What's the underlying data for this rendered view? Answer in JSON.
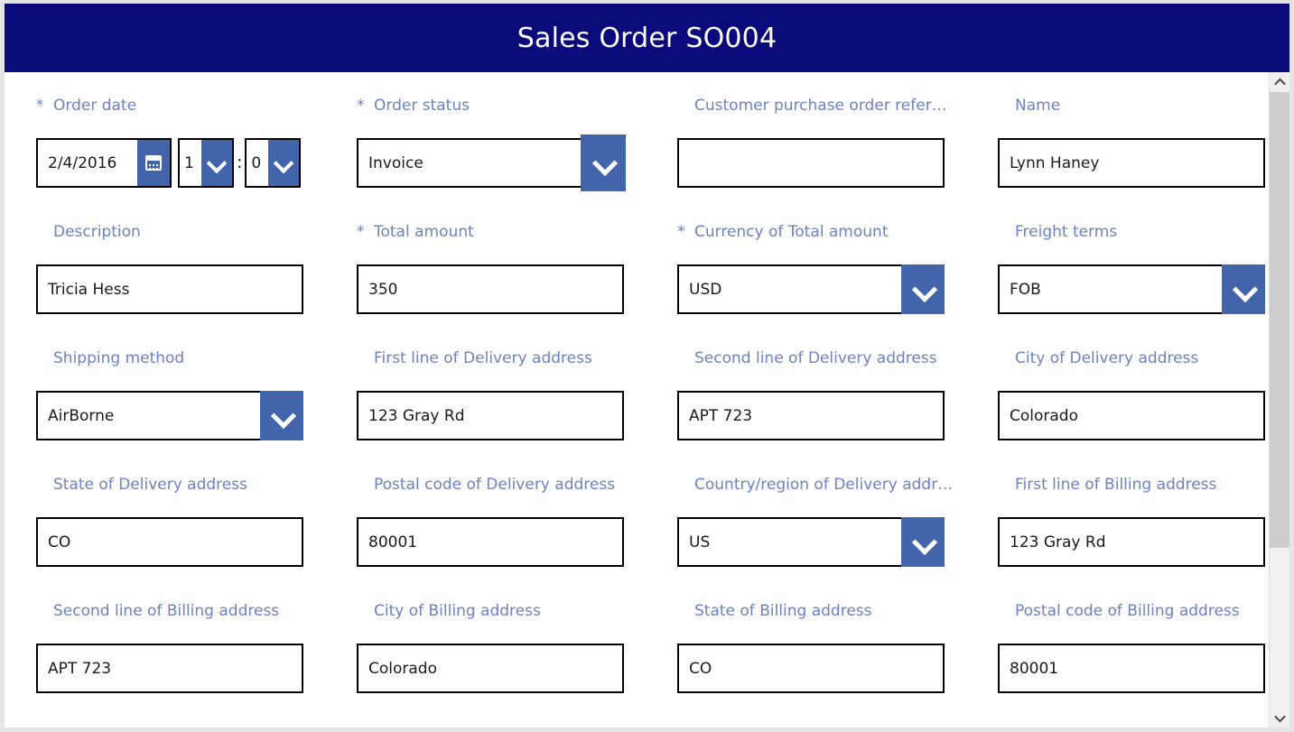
{
  "header": {
    "title": "Sales Order SO004",
    "background": "#0a0a7a",
    "text_color": "#ffffff"
  },
  "theme": {
    "label_color": "#6b83c4",
    "accent_button": "#4264ab",
    "field_border": "#000000",
    "panel_background": "#ffffff",
    "page_background": "#e4e4e4"
  },
  "form": {
    "required_marker": "*",
    "fields": [
      {
        "label": "Order date",
        "required": true,
        "type": "datetime",
        "date_value": "2/4/2016",
        "hour_value": "1",
        "time_separator": ":",
        "minute_value": "0",
        "calendar_icon": "calendar-icon",
        "chevron_icon": "chevron-down-icon"
      },
      {
        "label": "Order status",
        "required": true,
        "type": "dropdown",
        "value": "Invoice",
        "focused": true,
        "chevron_icon": "chevron-down-icon"
      },
      {
        "label": "Customer purchase order refer…",
        "required": false,
        "type": "text",
        "value": ""
      },
      {
        "label": "Name",
        "required": false,
        "type": "text",
        "value": "Lynn Haney"
      },
      {
        "label": "Description",
        "required": false,
        "type": "text",
        "value": "Tricia Hess"
      },
      {
        "label": "Total amount",
        "required": true,
        "type": "text",
        "value": "350"
      },
      {
        "label": "Currency of Total amount",
        "required": true,
        "type": "dropdown",
        "value": "USD",
        "chevron_icon": "chevron-down-icon"
      },
      {
        "label": "Freight terms",
        "required": false,
        "type": "dropdown",
        "value": "FOB",
        "chevron_icon": "chevron-down-icon"
      },
      {
        "label": "Shipping method",
        "required": false,
        "type": "dropdown",
        "value": "AirBorne",
        "chevron_icon": "chevron-down-icon"
      },
      {
        "label": "First line of Delivery address",
        "required": false,
        "type": "text",
        "value": "123 Gray Rd"
      },
      {
        "label": "Second line of Delivery address",
        "required": false,
        "type": "text",
        "value": "APT 723"
      },
      {
        "label": "City of Delivery address",
        "required": false,
        "type": "text",
        "value": "Colorado"
      },
      {
        "label": "State of Delivery address",
        "required": false,
        "type": "text",
        "value": "CO"
      },
      {
        "label": "Postal code of Delivery address",
        "required": false,
        "type": "text",
        "value": "80001"
      },
      {
        "label": "Country/region of Delivery addr…",
        "required": false,
        "type": "dropdown",
        "value": "US",
        "chevron_icon": "chevron-down-icon"
      },
      {
        "label": "First line of Billing address",
        "required": false,
        "type": "text",
        "value": "123 Gray Rd"
      },
      {
        "label": "Second line of Billing address",
        "required": false,
        "type": "text",
        "value": "APT 723"
      },
      {
        "label": "City of Billing address",
        "required": false,
        "type": "text",
        "value": "Colorado"
      },
      {
        "label": "State of Billing address",
        "required": false,
        "type": "text",
        "value": "CO"
      },
      {
        "label": "Postal code of Billing address",
        "required": false,
        "type": "text",
        "value": "80001"
      }
    ]
  },
  "scrollbar": {
    "up_arrow_icon": "chevron-up-icon",
    "down_arrow_icon": "chevron-down-icon",
    "thumb_position": "top",
    "thumb_size_percent": 74
  }
}
